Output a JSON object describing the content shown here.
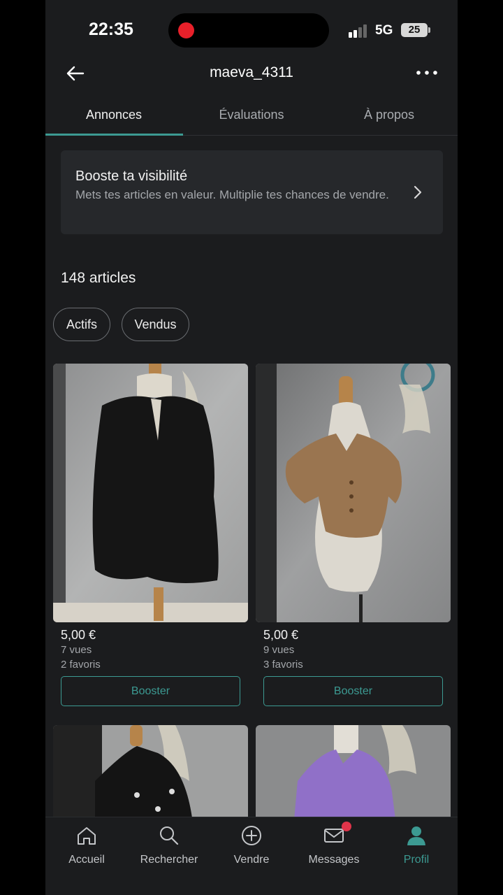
{
  "status_bar": {
    "time": "22:35",
    "network": "5G",
    "battery": "25"
  },
  "header": {
    "title": "maeva_4311",
    "back_icon": "arrow-left-icon",
    "more_icon": "more-dots-icon"
  },
  "tabs": [
    {
      "label": "Annonces",
      "active": true
    },
    {
      "label": "Évaluations",
      "active": false
    },
    {
      "label": "À propos",
      "active": false
    }
  ],
  "boost": {
    "title": "Booste ta visibilité",
    "text": "Mets tes articles en valeur. Multiplie tes chances de vendre."
  },
  "articles_count": "148 articles",
  "filters": [
    "Actifs",
    "Vendus"
  ],
  "items": [
    {
      "price": "5,00 €",
      "views": "7 vues",
      "favorites": "2 favoris",
      "button": "Booster"
    },
    {
      "price": "5,00 €",
      "views": "9 vues",
      "favorites": "3 favoris",
      "button": "Booster"
    }
  ],
  "nav": [
    {
      "label": "Accueil",
      "icon": "home-icon"
    },
    {
      "label": "Rechercher",
      "icon": "search-icon"
    },
    {
      "label": "Vendre",
      "icon": "plus-circle-icon"
    },
    {
      "label": "Messages",
      "icon": "mail-icon"
    },
    {
      "label": "Profil",
      "icon": "profile-icon",
      "active": true
    }
  ],
  "colors": {
    "accent": "#3c9a92",
    "background": "#1b1c1e",
    "badge": "#e0344a"
  }
}
